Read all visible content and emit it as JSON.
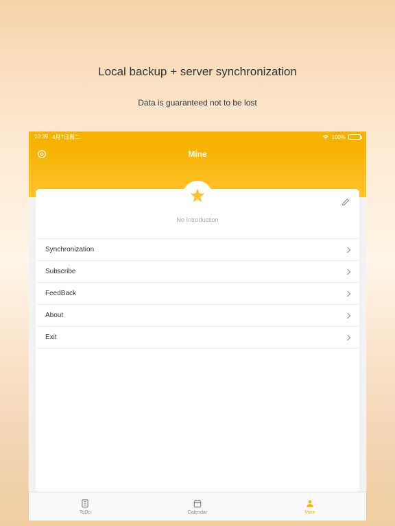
{
  "promo": {
    "title": "Local backup + server synchronization",
    "subtitle": "Data is guaranteed not to be lost"
  },
  "statusBar": {
    "time": "10:39",
    "date": "4月7日周二",
    "battery": "100%"
  },
  "header": {
    "title": "Mine"
  },
  "profile": {
    "intro": "No Introduction"
  },
  "menu": {
    "items": [
      {
        "label": "Synchronization"
      },
      {
        "label": "Subscribe"
      },
      {
        "label": "FeedBack"
      },
      {
        "label": "About"
      },
      {
        "label": "Exit"
      }
    ]
  },
  "tabs": {
    "items": [
      {
        "label": "ToDo"
      },
      {
        "label": "Calendar"
      },
      {
        "label": "Mine"
      }
    ]
  },
  "colors": {
    "accent": "#f6b200"
  }
}
